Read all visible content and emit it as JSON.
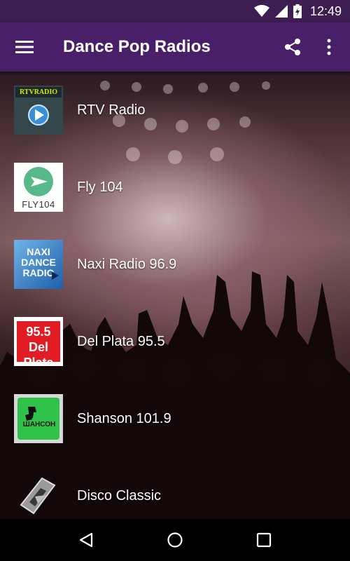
{
  "status_bar": {
    "time": "12:49"
  },
  "app_bar": {
    "title": "Dance Pop Radios"
  },
  "stations": [
    {
      "name": "RTV Radio",
      "logo_text": "RTVRADIO"
    },
    {
      "name": "Fly 104",
      "logo_text": "FLY104"
    },
    {
      "name": "Naxi Radio 96.9",
      "logo_text": "NAXI DANCE RADIO"
    },
    {
      "name": "Del Plata 95.5",
      "logo_text": "95.5 Del Plata"
    },
    {
      "name": "Shanson 101.9",
      "logo_text": "ШАНСОН"
    },
    {
      "name": "Disco Classic",
      "logo_text": ""
    }
  ],
  "colors": {
    "app_bar": "#4a1f6a",
    "status_bar": "#3e1d52",
    "text": "#ffffff"
  },
  "icons": {
    "status": [
      "wifi-icon",
      "signal-icon",
      "battery-charging-icon"
    ],
    "app_bar": [
      "menu-icon",
      "share-icon",
      "more-vert-icon"
    ],
    "nav": [
      "back-icon",
      "home-icon",
      "recents-icon"
    ]
  }
}
